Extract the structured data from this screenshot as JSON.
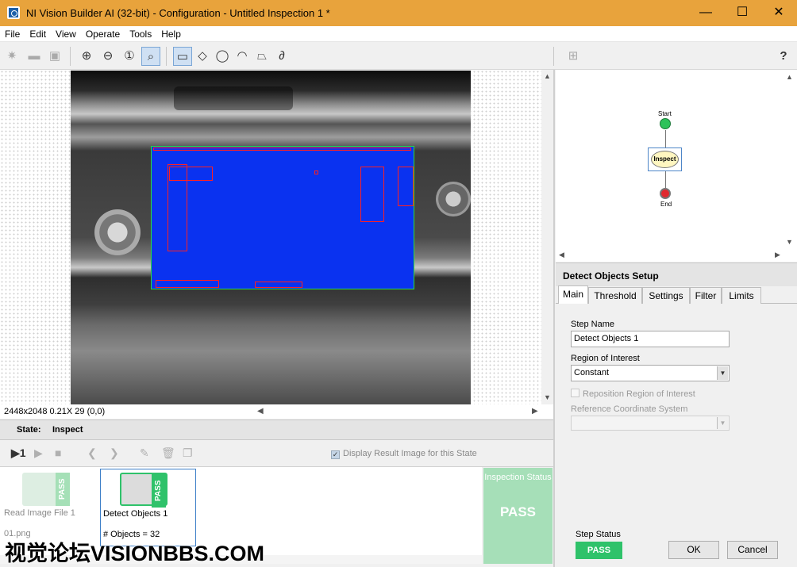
{
  "window": {
    "title": "NI Vision Builder AI (32-bit) - Configuration - Untitled Inspection 1 *",
    "minimize": "—",
    "maximize": "☐",
    "close": "✕"
  },
  "menu": [
    "File",
    "Edit",
    "View",
    "Operate",
    "Tools",
    "Help"
  ],
  "toolbar": {
    "help_glyph": "?"
  },
  "viewer": {
    "status_text": "2448x2048 0.21X 29    (0,0)"
  },
  "state": {
    "label": "State:",
    "value": "Inspect"
  },
  "step_toolbar": {
    "display_result_label": "Display Result Image for this State",
    "display_result_checked": true
  },
  "steps": [
    {
      "name": "Read Image File 1",
      "result": "01.png",
      "status": "PASS"
    },
    {
      "name": "Detect Objects 1",
      "result": "# Objects = 32",
      "status": "PASS"
    }
  ],
  "inspection_status": {
    "title": "Inspection Status",
    "value": "PASS"
  },
  "watermark": "视觉论坛VISIONBBS.COM",
  "flowchart": {
    "start": "Start",
    "inspect": "Inspect",
    "end": "End"
  },
  "setup": {
    "title": "Detect Objects Setup",
    "tabs": [
      "Main",
      "Threshold",
      "Settings",
      "Filter",
      "Limits"
    ],
    "step_name_label": "Step Name",
    "step_name_value": "Detect Objects 1",
    "roi_label": "Region of Interest",
    "roi_value": "Constant",
    "reposition_label": "Reposition Region of Interest",
    "ref_coord_label": "Reference Coordinate System",
    "ref_coord_value": "",
    "step_status_label": "Step Status",
    "step_status_value": "PASS",
    "ok_label": "OK",
    "cancel_label": "Cancel"
  },
  "colors": {
    "titlebar": "#e8a33c",
    "pass_green": "#2fc26a",
    "inspection_pass_bg": "#a6dfb8",
    "overlay_blue": "#0a32f0",
    "roi_green": "#29e03a",
    "particle_red": "#ff2020"
  }
}
